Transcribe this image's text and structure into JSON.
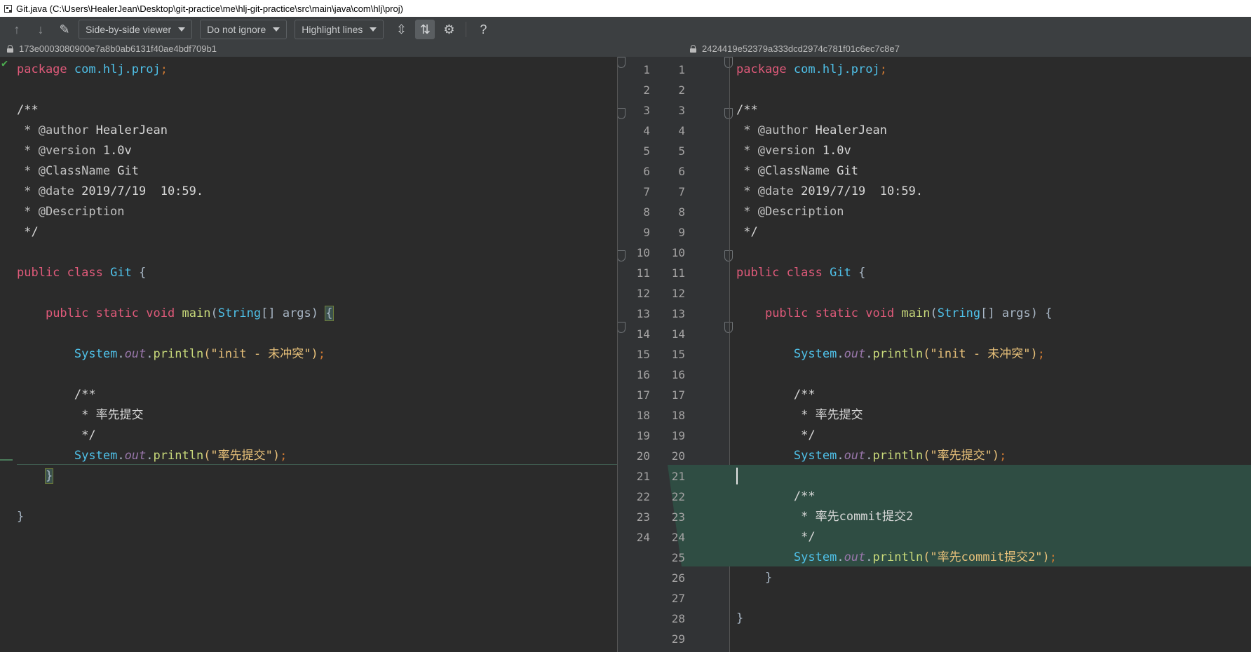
{
  "window": {
    "title": "Git.java (C:\\Users\\HealerJean\\Desktop\\git-practice\\me\\hlj-git-practice\\src\\main\\java\\com\\hlj\\proj)"
  },
  "toolbar": {
    "viewer": "Side-by-side viewer",
    "ignore": "Do not ignore",
    "highlight": "Highlight lines",
    "help": "?"
  },
  "left": {
    "hash": "173e0003080900e7a8b0ab6131f40ae4bdf709b1"
  },
  "right": {
    "hash": "2424419e52379a333dcd2974c781f01c6ec7c8e7"
  },
  "code": {
    "package_kw": "package",
    "package_name": "com.hlj.proj",
    "semi": ";",
    "doc_open": "/**",
    "author_tag": " * @author",
    "author": " HealerJean",
    "version_tag": " * @version",
    "version": " 1.0v",
    "classname_tag": " * @ClassName",
    "classname": " Git",
    "date_tag": " * @date",
    "date": " 2019/7/19  10:59.",
    "desc_tag": " * @Description",
    "doc_close": " */",
    "public": "public",
    "class": "class",
    "Git": "Git",
    "lbrace": "{",
    "rbrace": "}",
    "static": "static",
    "void": "void",
    "main": "main",
    "lparen": "(",
    "String": "String",
    "args": "[] args)",
    "System": "System",
    "dot": ".",
    "out": "out",
    "println": "println",
    "str_init": "(\"init - 未冲突\")",
    "indent_doc_open": "/**",
    "first_commit_comment": " * 率先提交",
    "indent_doc_close": " */",
    "str_first": "(\"率先提交\")",
    "commit2_comment": " * 率先commit提交2",
    "str_commit2": "(\"率先commit提交2\")"
  },
  "left_line_numbers": [
    "1",
    "2",
    "3",
    "4",
    "5",
    "6",
    "7",
    "8",
    "9",
    "10",
    "11",
    "12",
    "13",
    "14",
    "15",
    "16",
    "17",
    "18",
    "19",
    "20",
    "21",
    "22",
    "23",
    "24"
  ],
  "right_line_numbers": [
    "1",
    "2",
    "3",
    "4",
    "5",
    "6",
    "7",
    "8",
    "9",
    "10",
    "11",
    "12",
    "13",
    "14",
    "15",
    "16",
    "17",
    "18",
    "19",
    "20",
    "21",
    "22",
    "23",
    "24",
    "25",
    "26",
    "27",
    "28",
    "29"
  ],
  "colors": {
    "inserted": "#2f4d43",
    "background": "#2b2b2b",
    "gutter": "#313335"
  }
}
